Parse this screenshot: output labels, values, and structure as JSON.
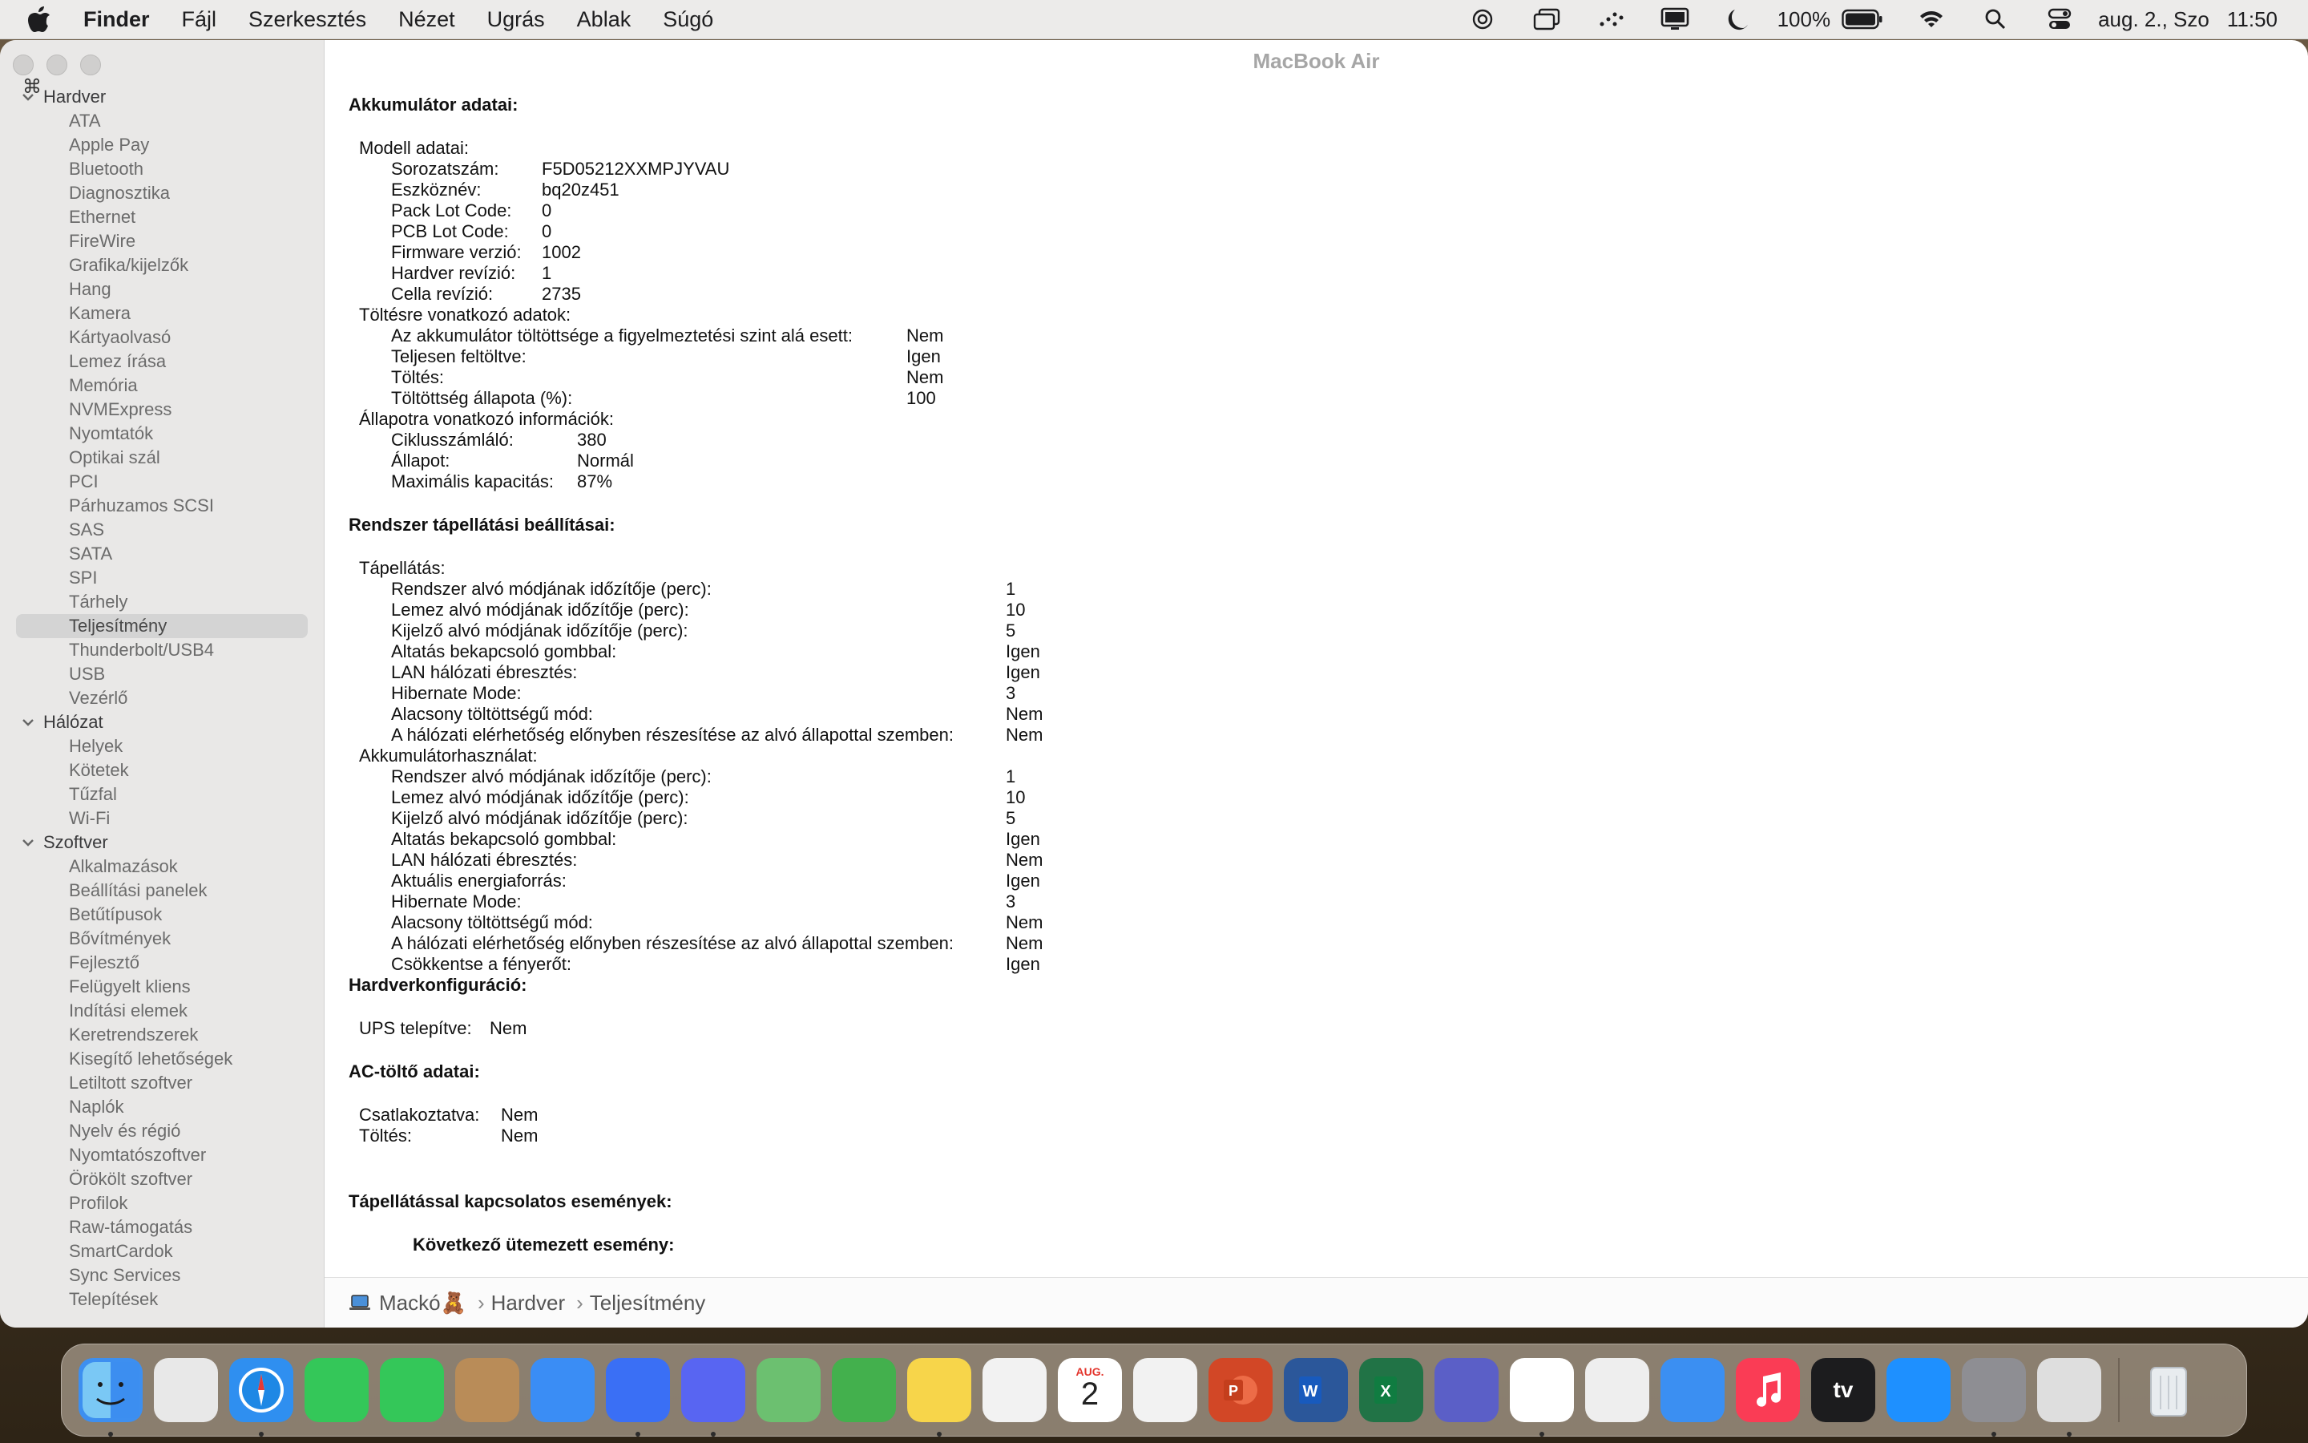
{
  "menubar": {
    "app": "Finder",
    "items": [
      "Fájl",
      "Szerkesztés",
      "Nézet",
      "Ugrás",
      "Ablak",
      "Súgó"
    ],
    "battery_pct": "100%",
    "datetime": "aug. 2., Szo",
    "time": "11:50"
  },
  "window": {
    "title": "MacBook Air"
  },
  "sidebar": {
    "groups": [
      {
        "label": "Hardver",
        "items": [
          "ATA",
          "Apple Pay",
          "Bluetooth",
          "Diagnosztika",
          "Ethernet",
          "FireWire",
          "Grafika/kijelzők",
          "Hang",
          "Kamera",
          "Kártyaolvasó",
          "Lemez írása",
          "Memória",
          "NVMExpress",
          "Nyomtatók",
          "Optikai szál",
          "PCI",
          "Párhuzamos SCSI",
          "SAS",
          "SATA",
          "SPI",
          "Tárhely",
          "Teljesítmény",
          "Thunderbolt/USB4",
          "USB",
          "Vezérlő"
        ]
      },
      {
        "label": "Hálózat",
        "items": [
          "Helyek",
          "Kötetek",
          "Tűzfal",
          "Wi-Fi"
        ]
      },
      {
        "label": "Szoftver",
        "items": [
          "Alkalmazások",
          "Beállítási panelek",
          "Betűtípusok",
          "Bővítmények",
          "Fejlesztő",
          "Felügyelt kliens",
          "Indítási elemek",
          "Keretrendszerek",
          "Kisegítő lehetőségek",
          "Letiltott szoftver",
          "Naplók",
          "Nyelv és régió",
          "Nyomtatószoftver",
          "Örökölt szoftver",
          "Profilok",
          "Raw-támogatás",
          "SmartCardok",
          "Sync Services",
          "Telepítések"
        ]
      }
    ],
    "selected": "Teljesítmény"
  },
  "content": {
    "battery_title": "Akkumulátor adatai:",
    "model_header": "Modell adatai:",
    "model_rows": [
      [
        "Sorozatszám:",
        "F5D05212XXMPJYVAU"
      ],
      [
        "Eszköznév:",
        "bq20z451"
      ],
      [
        "Pack Lot Code:",
        "0"
      ],
      [
        "PCB Lot Code:",
        "0"
      ],
      [
        "Firmware verzió:",
        "1002"
      ],
      [
        "Hardver revízió:",
        "1"
      ],
      [
        "Cella revízió:",
        "2735"
      ]
    ],
    "charge_header": "Töltésre vonatkozó adatok:",
    "charge_rows": [
      [
        "Az akkumulátor töltöttsége a figyelmeztetési szint alá esett:",
        "Nem"
      ],
      [
        "Teljesen feltöltve:",
        "Igen"
      ],
      [
        "Töltés:",
        "Nem"
      ],
      [
        "Töltöttség állapota (%):",
        "100"
      ]
    ],
    "health_header": "Állapotra vonatkozó információk:",
    "health_rows": [
      [
        "Ciklusszámláló:",
        "380"
      ],
      [
        "Állapot:",
        "Normál"
      ],
      [
        "Maximális kapacitás:",
        "87%"
      ]
    ],
    "power_title": "Rendszer tápellátási beállításai:",
    "ac_header": "Tápellátás:",
    "ac_rows": [
      [
        "Rendszer alvó módjának időzítője (perc):",
        "1"
      ],
      [
        "Lemez alvó módjának időzítője (perc):",
        "10"
      ],
      [
        "Kijelző alvó módjának időzítője (perc):",
        "5"
      ],
      [
        "Altatás bekapcsoló gombbal:",
        "Igen"
      ],
      [
        "LAN hálózati ébresztés:",
        "Igen"
      ],
      [
        "Hibernate Mode:",
        "3"
      ],
      [
        "Alacsony töltöttségű mód:",
        "Nem"
      ],
      [
        "A hálózati elérhetőség előnyben részesítése az alvó állapottal szemben:",
        "Nem"
      ]
    ],
    "batt_use_header": "Akkumulátorhasználat:",
    "batt_use_rows": [
      [
        "Rendszer alvó módjának időzítője (perc):",
        "1"
      ],
      [
        "Lemez alvó módjának időzítője (perc):",
        "10"
      ],
      [
        "Kijelző alvó módjának időzítője (perc):",
        "5"
      ],
      [
        "Altatás bekapcsoló gombbal:",
        "Igen"
      ],
      [
        "LAN hálózati ébresztés:",
        "Nem"
      ],
      [
        "Aktuális energiaforrás:",
        "Igen"
      ],
      [
        "Hibernate Mode:",
        "3"
      ],
      [
        "Alacsony töltöttségű mód:",
        "Nem"
      ],
      [
        "A hálózati elérhetőség előnyben részesítése az alvó állapottal szemben:",
        "Nem"
      ],
      [
        "Csökkentse a fényerőt:",
        "Igen"
      ]
    ],
    "hwconf_title": "Hardverkonfiguráció:",
    "ups_label": "UPS telepítve:",
    "ups_value": "Nem",
    "ac_charger_title": "AC-töltő adatai:",
    "ac_charger_rows": [
      [
        "Csatlakoztatva:",
        "Nem"
      ],
      [
        "Töltés:",
        "Nem"
      ]
    ],
    "events_title": "Tápellátással kapcsolatos események:",
    "next_event_title": "Következő ütemezett esemény:"
  },
  "pathbar": {
    "items": [
      "Mackó🧸",
      "Hardver",
      "Teljesítmény"
    ],
    "separator": "›"
  },
  "dock": {
    "apps": [
      {
        "name": "Finder",
        "color": "#3d8ff0",
        "running": true
      },
      {
        "name": "Launchpad",
        "color": "#e8e8e8",
        "running": false
      },
      {
        "name": "Safari",
        "color": "#2f8ff0",
        "running": true
      },
      {
        "name": "FaceTime",
        "color": "#34c759",
        "running": false
      },
      {
        "name": "Messages",
        "color": "#34c759",
        "running": false
      },
      {
        "name": "Contacts",
        "color": "#b98c58",
        "running": false
      },
      {
        "name": "Mail",
        "color": "#3a8df5",
        "running": false
      },
      {
        "name": "Messenger",
        "color": "#3a6ff5",
        "running": true
      },
      {
        "name": "Discord",
        "color": "#5865f2",
        "running": true
      },
      {
        "name": "Maps",
        "color": "#6cc070",
        "running": false
      },
      {
        "name": "Find My",
        "color": "#43b04d",
        "running": false
      },
      {
        "name": "Notes",
        "color": "#f7d54a",
        "running": true
      },
      {
        "name": "Photos",
        "color": "#f2f2f2",
        "running": false
      },
      {
        "name": "Calendar",
        "color": "#ffffff",
        "running": false
      },
      {
        "name": "Freeform",
        "color": "#f2f2f2",
        "running": false
      },
      {
        "name": "PowerPoint",
        "color": "#d24726",
        "running": false
      },
      {
        "name": "Word",
        "color": "#2b579a",
        "running": false
      },
      {
        "name": "Excel",
        "color": "#217346",
        "running": false
      },
      {
        "name": "Teams",
        "color": "#5b5fc7",
        "running": false
      },
      {
        "name": "ChatGPT",
        "color": "#ffffff",
        "running": true
      },
      {
        "name": "Print Center",
        "color": "#eeeeee",
        "running": false
      },
      {
        "name": "Weather",
        "color": "#3b8ff2",
        "running": false
      },
      {
        "name": "Music",
        "color": "#fa3c55",
        "running": false
      },
      {
        "name": "Apple TV",
        "color": "#1c1c1e",
        "running": false
      },
      {
        "name": "App Store",
        "color": "#1e90ff",
        "running": false
      },
      {
        "name": "System Settings",
        "color": "#8e8e93",
        "running": true
      },
      {
        "name": "System Information",
        "color": "#dedede",
        "running": true
      },
      {
        "name": "Trash",
        "color": "#d0d4d8",
        "running": false
      }
    ],
    "calendar_month": "AUG.",
    "calendar_day": "2",
    "appletv_label": "tv"
  }
}
